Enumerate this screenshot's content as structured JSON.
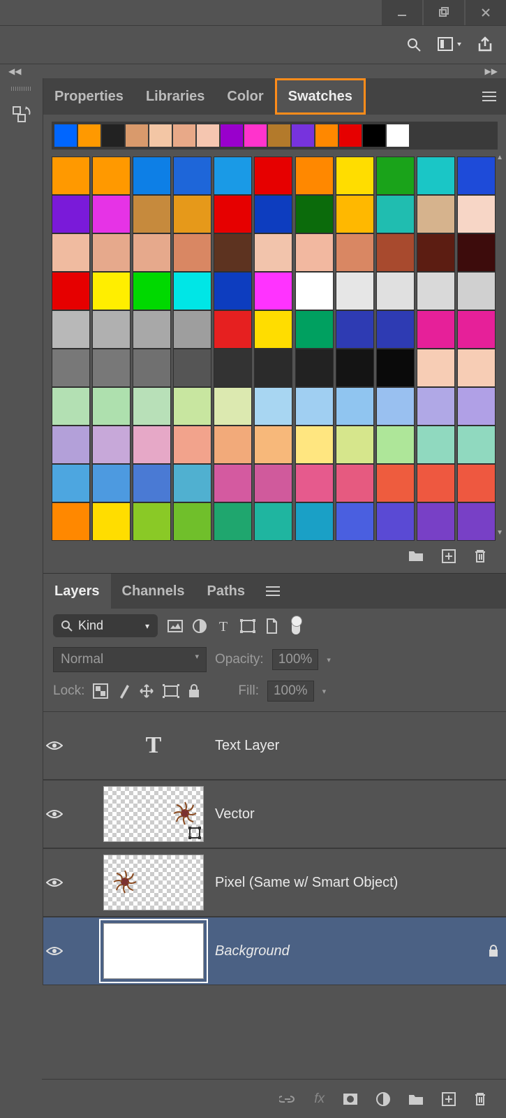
{
  "window": {
    "minimize": "_",
    "maximize": "❐",
    "close": "✕"
  },
  "panel_tabs": {
    "properties": "Properties",
    "libraries": "Libraries",
    "color": "Color",
    "swatches": "Swatches",
    "active": "swatches"
  },
  "recent_swatches": [
    "#0066ff",
    "#ff9900",
    "#222222",
    "#d99a6c",
    "#f3c6a5",
    "#e8a988",
    "#f5c6b0",
    "#9900cc",
    "#ff33cc",
    "#b37a2b",
    "#7733dd",
    "#ff8800",
    "#e60000",
    "#000000",
    "#ffffff"
  ],
  "swatches": [
    "#ff9900",
    "#ff9900",
    "#0d7fe6",
    "#1e66d9",
    "#1a9ae6",
    "#e60000",
    "#ff8800",
    "#ffdd00",
    "#1aa31a",
    "#1ac6c6",
    "#1e4bd9",
    "#7a1ad9",
    "#e633e6",
    "#c68a3d",
    "#e6991a",
    "#e60000",
    "#0d3dbf",
    "#0b6b0b",
    "#ffb800",
    "#20bdb0",
    "#d6b38d",
    "#f7d6c6",
    "#f0bba0",
    "#e6a98c",
    "#e6a98c",
    "#d98763",
    "#5d3320",
    "#f2c4ac",
    "#f2b8a0",
    "#d98763",
    "#a84a2e",
    "#5c1d12",
    "#3d0c0c",
    "#e60000",
    "#ffee00",
    "#00d900",
    "#00e6e6",
    "#0d3dbf",
    "#ff33ff",
    "#ffffff",
    "#e6e6e6",
    "#e0e0e0",
    "#d9d9d9",
    "#d0d0d0",
    "#b8b8b8",
    "#b0b0b0",
    "#a8a8a8",
    "#9e9e9e",
    "#e62020",
    "#ffdd00",
    "#00a060",
    "#2e3bb3",
    "#2e3bb3",
    "#e62099",
    "#e62099",
    "#787878",
    "#787878",
    "#707070",
    "#555555",
    "#333333",
    "#2b2b2b",
    "#222222",
    "#141414",
    "#0a0a0a",
    "#f7cdb5",
    "#f7cdb5",
    "#b3e0b3",
    "#aee0ae",
    "#b8e0b8",
    "#c8e6a0",
    "#dce9b0",
    "#a8d6f2",
    "#a0cff2",
    "#90c5f0",
    "#99c0f0",
    "#b0a8e6",
    "#b0a0e6",
    "#b3a0d9",
    "#c7a8d9",
    "#e6a8c7",
    "#f2a38c",
    "#f2aa7a",
    "#f7b87a",
    "#ffe680",
    "#d6e68c",
    "#aee699",
    "#90d9bf",
    "#90d9bf",
    "#4da6e0",
    "#4d9ae0",
    "#4a7ad4",
    "#50b0d0",
    "#d45aa0",
    "#d05a9c",
    "#e65a8d",
    "#e65a80",
    "#ee5c3e",
    "#ee5840",
    "#ee5840",
    "#ff8800",
    "#ffdd00",
    "#8ac926",
    "#70bf2b",
    "#1fa66e",
    "#1fb5a0",
    "#1aa0c6",
    "#4a5fe0",
    "#5a4ad4",
    "#7840c6",
    "#7840c6"
  ],
  "swatch_actions": {
    "folder": "folder",
    "new": "new",
    "trash": "trash"
  },
  "layers_tabs": {
    "layers": "Layers",
    "channels": "Channels",
    "paths": "Paths",
    "active": "layers"
  },
  "kind_filter": {
    "label": "Kind"
  },
  "blend": {
    "mode": "Normal",
    "opacity_label": "Opacity:",
    "opacity": "100%"
  },
  "lock": {
    "label": "Lock:",
    "fill_label": "Fill:",
    "fill": "100%"
  },
  "layers": [
    {
      "name": "Text Layer",
      "type": "text",
      "visible": true
    },
    {
      "name": "Vector",
      "type": "vector",
      "visible": true
    },
    {
      "name": "Pixel (Same w/ Smart Object)",
      "type": "pixel",
      "visible": true
    },
    {
      "name": "Background",
      "type": "background",
      "visible": true,
      "locked": true,
      "selected": true
    }
  ],
  "bottom_icons": [
    "link",
    "fx",
    "mask",
    "adjust",
    "group",
    "new",
    "trash"
  ]
}
